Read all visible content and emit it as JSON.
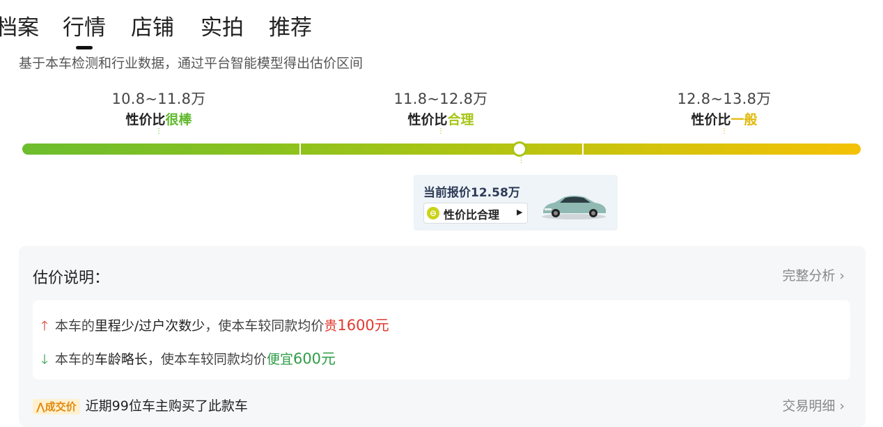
{
  "tabs": [
    {
      "label": "档案"
    },
    {
      "label": "行情",
      "active": true
    },
    {
      "label": "店铺"
    },
    {
      "label": "实拍"
    },
    {
      "label": "推荐"
    }
  ],
  "description": "基于本车检测和行业数据，通过平台智能模型得出估价区间",
  "ranges": [
    {
      "price": "10.8~11.8万",
      "prefix": "性价比",
      "grade": "很棒",
      "color": "#5fb92c"
    },
    {
      "price": "11.8~12.8万",
      "prefix": "性价比",
      "grade": "合理",
      "color": "#a6c516"
    },
    {
      "price": "12.8~13.8万",
      "prefix": "性价比",
      "grade": "一般",
      "color": "#e0b90a"
    }
  ],
  "current": {
    "label": "当前报价12.58万",
    "value_wan": 12.58,
    "scale_min_wan": 10.8,
    "scale_max_wan": 13.8,
    "chip_text": "性价比合理",
    "chip_icon": "neutral-face-icon",
    "chip_arrow": "▶"
  },
  "explain": {
    "title": "估价说明：",
    "more": "完整分析 ›",
    "items": [
      {
        "dir": "up",
        "pre": "本车的",
        "key": "里程少/过户次数少",
        "mid": "，使本车较同款均价",
        "effect": "贵",
        "amount": "1600元"
      },
      {
        "dir": "down",
        "pre": "本车的",
        "key": "车龄略长",
        "mid": "，使本车较同款均价",
        "effect": "便宜",
        "amount": "600元"
      }
    ]
  },
  "deal": {
    "tag": "成交价",
    "text": "近期99位车主购买了此款车",
    "more": "交易明细 ›"
  },
  "colors": {
    "accent_green": "#2e9d45",
    "accent_red": "#e03b2f",
    "bar_start": "#6cbd2e",
    "bar_end": "#f4c106"
  }
}
